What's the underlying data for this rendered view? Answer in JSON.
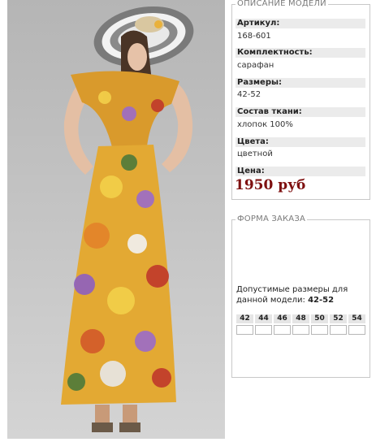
{
  "product_image": {
    "alt": ""
  },
  "description": {
    "legend": "ОПИСАНИЕ МОДЕЛИ",
    "fields": [
      {
        "label": "Артикул:",
        "value": "168-601"
      },
      {
        "label": "Комплектность:",
        "value": "сарафан"
      },
      {
        "label": "Размеры:",
        "value": "42-52"
      },
      {
        "label": "Состав ткани:",
        "value": "хлопок 100%"
      },
      {
        "label": "Цвета:",
        "value": "цветной"
      }
    ],
    "price_label": "Цена:",
    "price": "1950 руб"
  },
  "order": {
    "legend": "ФОРМА ЗАКАЗА",
    "text": "Допустимые размеры для данной модели:",
    "sizes_allowed": "42-52",
    "sizes": [
      "42",
      "44",
      "46",
      "48",
      "50",
      "52",
      "54"
    ]
  },
  "colors": {
    "price": "#7e1010",
    "label_bg": "#ebebeb",
    "border": "#c8c8c8"
  }
}
